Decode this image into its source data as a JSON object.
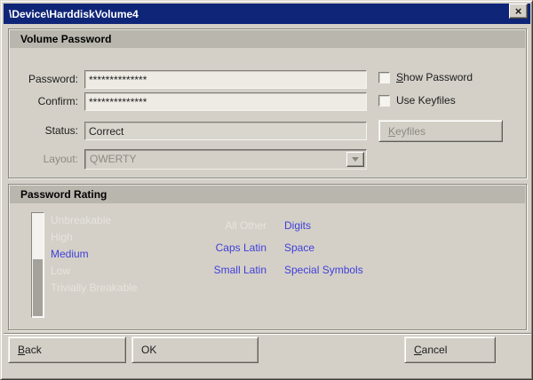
{
  "window": {
    "title": "\\Device\\HarddiskVolume4",
    "close_glyph": "×"
  },
  "volume_password": {
    "header": "Volume Password",
    "fields": {
      "password": {
        "label": "Password:",
        "value": "**************"
      },
      "confirm": {
        "label": "Confirm:",
        "value": "**************"
      },
      "status": {
        "label": "Status:",
        "value": "Correct"
      },
      "layout": {
        "label": "Layout:",
        "value": "QWERTY"
      }
    },
    "show_password_label": "Show Password",
    "use_keyfiles_label": "Use Keyfiles",
    "keyfiles_button_label": "Keyfiles"
  },
  "password_rating": {
    "header": "Password Rating",
    "gauge_fill_percent": 55,
    "levels": [
      {
        "label": "Unbreakable",
        "active": false
      },
      {
        "label": "High",
        "active": false
      },
      {
        "label": "Medium",
        "active": true
      },
      {
        "label": "Low",
        "active": false
      },
      {
        "label": "Trivially Breakable",
        "active": false
      }
    ],
    "char_classes_middle": [
      {
        "label": "All Other",
        "active": false
      },
      {
        "label": "Caps Latin",
        "active": true
      },
      {
        "label": "Small Latin",
        "active": true
      }
    ],
    "char_classes_right": [
      {
        "label": "Digits",
        "active": true
      },
      {
        "label": "Space",
        "active": true
      },
      {
        "label": "Special Symbols",
        "active": true
      }
    ]
  },
  "buttons": {
    "back": "Back",
    "ok": "OK",
    "cancel": "Cancel"
  },
  "colors": {
    "titlebar": "#0f2578",
    "accent_blue": "#3f3fd9",
    "header_bar": "#b9b6ae",
    "window_bg": "#d4d0c8"
  }
}
